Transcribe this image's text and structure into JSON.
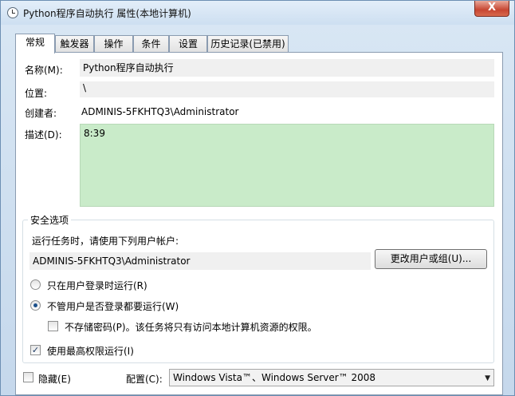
{
  "window": {
    "title": "Python程序自动执行 属性(本地计算机)",
    "close_glyph": "X"
  },
  "tabs": [
    {
      "label": "常规",
      "active": true
    },
    {
      "label": "触发器",
      "active": false
    },
    {
      "label": "操作",
      "active": false
    },
    {
      "label": "条件",
      "active": false
    },
    {
      "label": "设置",
      "active": false
    },
    {
      "label": "历史记录(已禁用)",
      "active": false
    }
  ],
  "general": {
    "name_label": "名称(M):",
    "name_value": "Python程序自动执行",
    "location_label": "位置:",
    "location_value": "\\",
    "author_label": "创建者:",
    "author_value": "ADMINIS-5FKHTQ3\\Administrator",
    "description_label": "描述(D):",
    "description_value": "8:39"
  },
  "security": {
    "group_title": "安全选项",
    "run_as_prompt": "运行任务时，请使用下列用户帐户:",
    "user_account": "ADMINIS-5FKHTQ3\\Administrator",
    "change_user_button": "更改用户或组(U)...",
    "radio_logged_on": "只在用户登录时运行(R)",
    "radio_whether_logged_on": "不管用户是否登录都要运行(W)",
    "radio_selected": "whether_logged_on",
    "no_store_password": "不存储密码(P)。该任务将只有访问本地计算机资源的权限。",
    "no_store_password_checked": false,
    "highest_privileges": "使用最高权限运行(I)",
    "highest_privileges_checked": true,
    "check_glyph": "✓"
  },
  "bottom": {
    "hidden_label": "隐藏(E)",
    "hidden_checked": false,
    "configure_label": "配置(C):",
    "configure_value": "Windows Vista™、Windows Server™ 2008",
    "dropdown_glyph": "▼"
  },
  "colors": {
    "description_bg": "#c9ebc9",
    "radio_dot": "#1b4f8a",
    "close_button": "#c74632"
  }
}
